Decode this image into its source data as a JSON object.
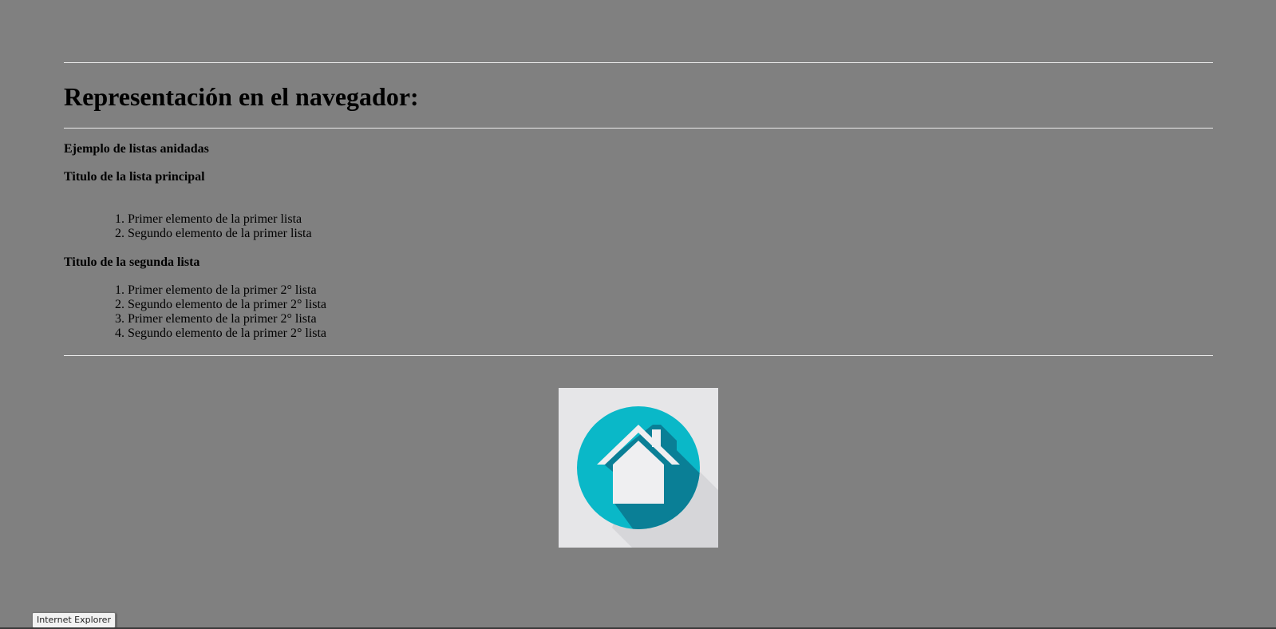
{
  "page": {
    "heading": "Representación en el navegador:",
    "example_title": "Ejemplo de listas anidadas",
    "main_list": {
      "title": "Titulo de la lista principal",
      "items": [
        "Primer elemento de la primer lista",
        "Segundo elemento de la primer lista"
      ]
    },
    "second_list": {
      "title": "Titulo de la segunda lista",
      "items": [
        "Primer elemento de la primer 2° lista",
        "Segundo elemento de la primer 2° lista",
        "Primer elemento de la primer 2° lista",
        "Segundo elemento de la primer 2° lista"
      ]
    },
    "logo": {
      "icon": "home-icon",
      "colors": {
        "background": "#e6e6e8",
        "circle": "#0ab8c8",
        "shadow": "#0a7f96",
        "house": "#efeff1"
      }
    }
  },
  "taskbar": {
    "tooltip": "Internet Explorer"
  },
  "colors": {
    "page_background": "#808080",
    "rule": "#ececec"
  }
}
